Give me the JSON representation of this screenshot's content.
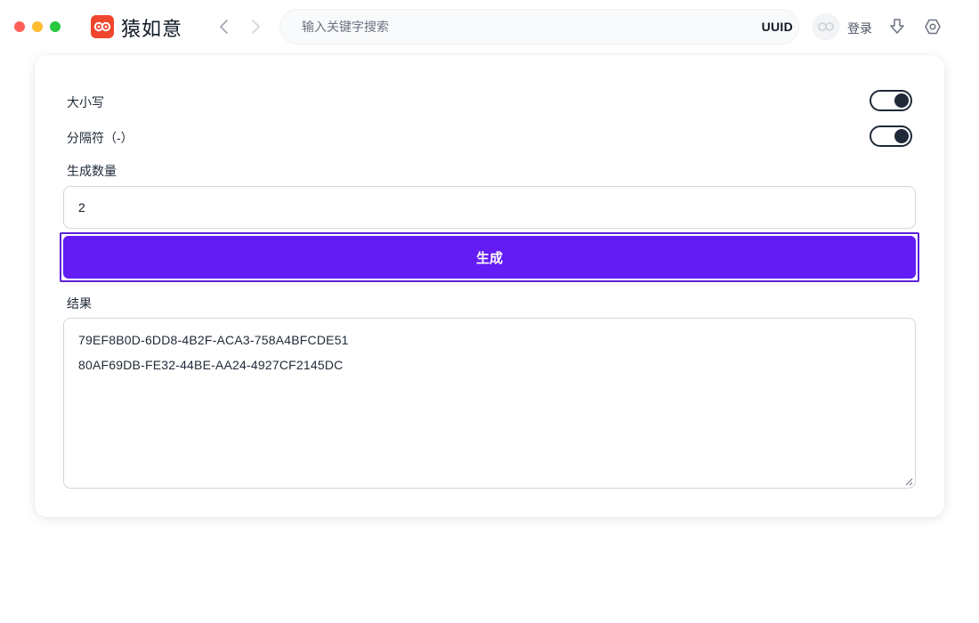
{
  "app": {
    "name": "猿如意",
    "brand_color": "#f0462d"
  },
  "search": {
    "placeholder": "输入关键字搜索",
    "tool_tag": "UUID"
  },
  "header": {
    "login_label": "登录",
    "icons": [
      "chevron-left-icon",
      "chevron-right-icon",
      "avatar-icon",
      "download-icon",
      "settings-icon"
    ]
  },
  "form": {
    "uppercase_label": "大小写",
    "uppercase_on": true,
    "separator_label": "分隔符（-）",
    "separator_on": true,
    "count_label": "生成数量",
    "count_value": "2",
    "generate_label": "生成",
    "accent_color": "#631cf3",
    "result_label": "结果",
    "results": [
      "79EF8B0D-6DD8-4B2F-ACA3-758A4BFCDE51",
      "80AF69DB-FE32-44BE-AA24-4927CF2145DC"
    ]
  }
}
